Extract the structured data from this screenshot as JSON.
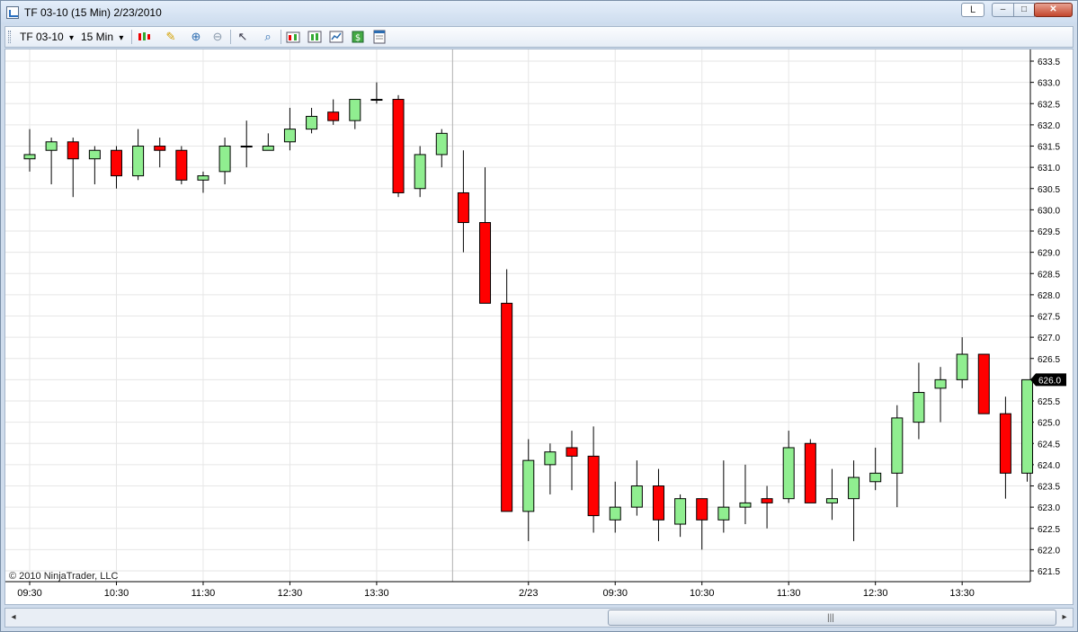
{
  "window": {
    "title": "TF 03-10 (15 Min)  2/23/2010"
  },
  "window_buttons": {
    "layout": "L",
    "minimize": "–",
    "maximize": "□",
    "close": "✕"
  },
  "toolbar": {
    "instrument": "TF 03-10",
    "interval": "15 Min",
    "dropdown_arrow": "▾",
    "icons": [
      "candlestick-style-icon",
      "pencil-draw-icon",
      "zoom-in-icon",
      "zoom-out-icon",
      "pointer-cursor-icon",
      "magnifier-icon",
      "strategies-icon",
      "indicators-icon",
      "chart-properties-icon",
      "dollar-icon",
      "data-box-icon"
    ]
  },
  "footer": {
    "copyright": "© 2010 NinjaTrader, LLC"
  },
  "scrollbar": {
    "left_arrow": "◂",
    "right_arrow": "▸",
    "grip": "|||"
  },
  "colors": {
    "up": "#90ee90",
    "down": "#ff0000",
    "grid": "#e6e6e6",
    "current_price_bg": "#000000"
  },
  "chart_data": {
    "type": "candlestick",
    "current_price": "626.0",
    "ylim": [
      621.3,
      633.7
    ],
    "y_ticks": [
      "621.5",
      "622.0",
      "622.5",
      "623.0",
      "623.5",
      "624.0",
      "624.5",
      "625.0",
      "625.5",
      "626.0",
      "626.5",
      "627.0",
      "627.5",
      "628.0",
      "628.5",
      "629.0",
      "629.5",
      "630.0",
      "630.5",
      "631.0",
      "631.5",
      "632.0",
      "632.5",
      "633.0",
      "633.5"
    ],
    "x_ticks": [
      {
        "bar": 0,
        "label": "09:30"
      },
      {
        "bar": 4,
        "label": "10:30"
      },
      {
        "bar": 8,
        "label": "11:30"
      },
      {
        "bar": 12,
        "label": "12:30"
      },
      {
        "bar": 16,
        "label": "13:30"
      },
      {
        "bar": 23,
        "label": "2/23"
      },
      {
        "bar": 27,
        "label": "09:30"
      },
      {
        "bar": 31,
        "label": "10:30"
      },
      {
        "bar": 35,
        "label": "11:30"
      },
      {
        "bar": 39,
        "label": "12:30"
      },
      {
        "bar": 43,
        "label": "13:30"
      }
    ],
    "session_break_after_bar": 19,
    "candles": [
      {
        "o": 631.2,
        "h": 631.9,
        "l": 630.9,
        "c": 631.3
      },
      {
        "o": 631.4,
        "h": 631.7,
        "l": 630.6,
        "c": 631.6
      },
      {
        "o": 631.6,
        "h": 631.7,
        "l": 630.3,
        "c": 631.2
      },
      {
        "o": 631.2,
        "h": 631.5,
        "l": 630.6,
        "c": 631.4
      },
      {
        "o": 631.4,
        "h": 631.5,
        "l": 630.5,
        "c": 630.8
      },
      {
        "o": 630.8,
        "h": 631.9,
        "l": 630.7,
        "c": 631.5
      },
      {
        "o": 631.5,
        "h": 631.7,
        "l": 631.0,
        "c": 631.4
      },
      {
        "o": 631.4,
        "h": 631.5,
        "l": 630.6,
        "c": 630.7
      },
      {
        "o": 630.7,
        "h": 630.9,
        "l": 630.4,
        "c": 630.8
      },
      {
        "o": 630.9,
        "h": 631.7,
        "l": 630.6,
        "c": 631.5
      },
      {
        "o": 631.5,
        "h": 632.1,
        "l": 631.0,
        "c": 631.5
      },
      {
        "o": 631.4,
        "h": 631.8,
        "l": 631.4,
        "c": 631.5
      },
      {
        "o": 631.6,
        "h": 632.4,
        "l": 631.4,
        "c": 631.9
      },
      {
        "o": 631.9,
        "h": 632.4,
        "l": 631.8,
        "c": 632.2
      },
      {
        "o": 632.3,
        "h": 632.6,
        "l": 632.0,
        "c": 632.1
      },
      {
        "o": 632.1,
        "h": 632.6,
        "l": 631.9,
        "c": 632.6
      },
      {
        "o": 632.6,
        "h": 633.0,
        "l": 632.5,
        "c": 632.6
      },
      {
        "o": 632.6,
        "h": 632.7,
        "l": 630.3,
        "c": 630.4
      },
      {
        "o": 630.5,
        "h": 631.5,
        "l": 630.3,
        "c": 631.3
      },
      {
        "o": 631.3,
        "h": 631.9,
        "l": 631.0,
        "c": 631.8
      },
      {
        "o": 630.4,
        "h": 631.4,
        "l": 629.0,
        "c": 629.7
      },
      {
        "o": 629.7,
        "h": 631.0,
        "l": 627.8,
        "c": 627.8
      },
      {
        "o": 627.8,
        "h": 628.6,
        "l": 622.9,
        "c": 622.9
      },
      {
        "o": 622.9,
        "h": 624.6,
        "l": 622.2,
        "c": 624.1
      },
      {
        "o": 624.0,
        "h": 624.5,
        "l": 623.3,
        "c": 624.3
      },
      {
        "o": 624.4,
        "h": 624.8,
        "l": 623.4,
        "c": 624.2
      },
      {
        "o": 624.2,
        "h": 624.9,
        "l": 622.4,
        "c": 622.8
      },
      {
        "o": 622.7,
        "h": 623.6,
        "l": 622.4,
        "c": 623.0
      },
      {
        "o": 623.0,
        "h": 624.1,
        "l": 622.8,
        "c": 623.5
      },
      {
        "o": 623.5,
        "h": 623.9,
        "l": 622.2,
        "c": 622.7
      },
      {
        "o": 622.6,
        "h": 623.3,
        "l": 622.3,
        "c": 623.2
      },
      {
        "o": 623.2,
        "h": 623.2,
        "l": 622.0,
        "c": 622.7
      },
      {
        "o": 622.7,
        "h": 624.1,
        "l": 622.4,
        "c": 623.0
      },
      {
        "o": 623.0,
        "h": 624.0,
        "l": 622.6,
        "c": 623.1
      },
      {
        "o": 623.2,
        "h": 623.5,
        "l": 622.5,
        "c": 623.1
      },
      {
        "o": 623.2,
        "h": 624.8,
        "l": 623.1,
        "c": 624.4
      },
      {
        "o": 624.5,
        "h": 624.6,
        "l": 623.1,
        "c": 623.1
      },
      {
        "o": 623.1,
        "h": 623.9,
        "l": 622.7,
        "c": 623.2
      },
      {
        "o": 623.2,
        "h": 624.1,
        "l": 622.2,
        "c": 623.7
      },
      {
        "o": 623.6,
        "h": 624.4,
        "l": 623.4,
        "c": 623.8
      },
      {
        "o": 623.8,
        "h": 625.4,
        "l": 623.0,
        "c": 625.1
      },
      {
        "o": 625.0,
        "h": 626.4,
        "l": 624.6,
        "c": 625.7
      },
      {
        "o": 625.8,
        "h": 626.3,
        "l": 625.0,
        "c": 626.0
      },
      {
        "o": 626.0,
        "h": 627.0,
        "l": 625.8,
        "c": 626.6
      },
      {
        "o": 626.6,
        "h": 626.6,
        "l": 625.2,
        "c": 625.2
      },
      {
        "o": 625.2,
        "h": 625.6,
        "l": 623.2,
        "c": 623.8
      },
      {
        "o": 623.8,
        "h": 626.0,
        "l": 623.6,
        "c": 626.0
      }
    ]
  }
}
